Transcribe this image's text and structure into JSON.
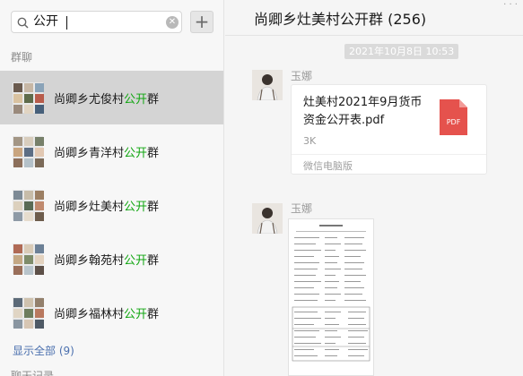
{
  "search": {
    "value": "公开",
    "clear_icon": "close-circle-icon",
    "add_icon": "plus-icon"
  },
  "sections": {
    "group_chats": "群聊",
    "chat_history": "聊天记录"
  },
  "results": [
    {
      "prefix": "尚卿乡尤俊村",
      "highlight": "公开",
      "suffix": "群",
      "active": true
    },
    {
      "prefix": "尚卿乡青洋村",
      "highlight": "公开",
      "suffix": "群",
      "active": false
    },
    {
      "prefix": "尚卿乡灶美村",
      "highlight": "公开",
      "suffix": "群",
      "active": false
    },
    {
      "prefix": "尚卿乡翰苑村",
      "highlight": "公开",
      "suffix": "群",
      "active": false
    },
    {
      "prefix": "尚卿乡福林村",
      "highlight": "公开",
      "suffix": "群",
      "active": false
    }
  ],
  "show_all": "显示全部 (9)",
  "chat": {
    "title": "尚卿乡灶美村公开群 (256)",
    "timestamp": "2021年10月8日 10:53",
    "messages": [
      {
        "sender": "玉娜",
        "type": "file",
        "file_name": "灶美村2021年9月货币资金公开表.pdf",
        "file_size": "3K",
        "file_type": "PDF",
        "source": "微信电脑版"
      },
      {
        "sender": "玉娜",
        "type": "image"
      }
    ]
  },
  "colors": {
    "highlight": "#11a611",
    "pdf_red": "#e5524d",
    "active_row": "#d4d4d4",
    "link": "#4a6fae"
  }
}
